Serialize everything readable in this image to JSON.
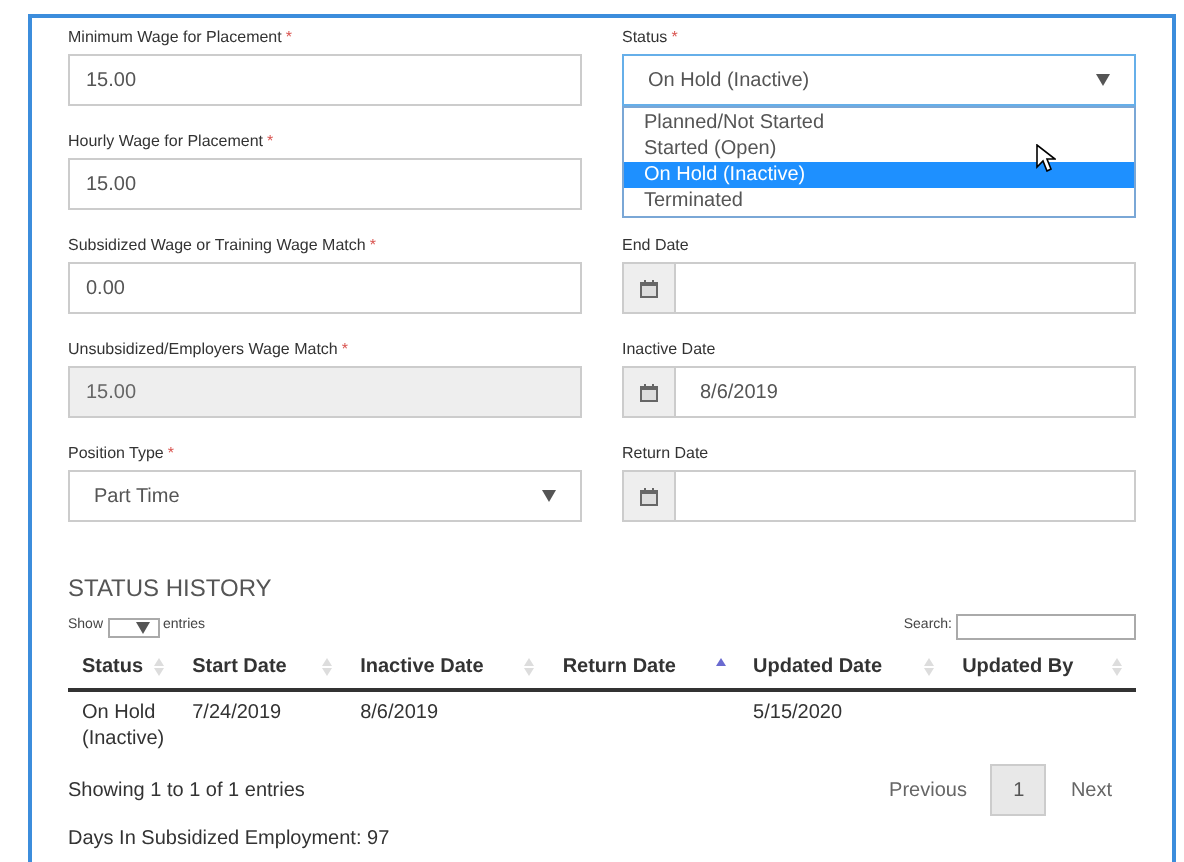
{
  "left_fields": [
    {
      "label": "Minimum Wage for Placement",
      "required_mark": "*",
      "kind": "text",
      "value": "15.00",
      "disabled": false
    },
    {
      "label": "Hourly Wage for Placement",
      "required_mark": "*",
      "kind": "text",
      "value": "15.00",
      "disabled": false
    },
    {
      "label": "Subsidized Wage or Training Wage Match",
      "required_mark": "*",
      "kind": "text",
      "value": "0.00",
      "disabled": false
    },
    {
      "label": "Unsubsidized/Employers Wage Match",
      "required_mark": "*",
      "kind": "text",
      "value": "15.00",
      "disabled": true
    },
    {
      "label": "Position Type",
      "required_mark": "*",
      "kind": "select",
      "value": "Part Time",
      "disabled": false
    }
  ],
  "status": {
    "label": "Status",
    "required_mark": "*",
    "value": "On Hold (Inactive)",
    "options": [
      {
        "label": "Planned/Not Started",
        "selected": false
      },
      {
        "label": "Started (Open)",
        "selected": false
      },
      {
        "label": "On Hold (Inactive)",
        "selected": true
      },
      {
        "label": "Terminated",
        "selected": false
      }
    ]
  },
  "right_fields": [
    {
      "label": "End Date",
      "kind": "date"
    },
    {
      "label": "Inactive Date",
      "kind": "date",
      "value": "8/6/2019"
    },
    {
      "label": "Return Date",
      "kind": "date"
    }
  ],
  "history": {
    "title": "STATUS HISTORY",
    "show_label": "Show",
    "entries_label": "entries",
    "search_label": "Search:",
    "columns": [
      {
        "label": "Status",
        "sorted": false
      },
      {
        "label": "Start Date",
        "sorted": false
      },
      {
        "label": "Inactive Date",
        "sorted": false
      },
      {
        "label": "Return Date",
        "sorted": true
      },
      {
        "label": "Updated Date",
        "sorted": false
      },
      {
        "label": "Updated By",
        "sorted": false
      }
    ],
    "rows": [
      [
        "On Hold (Inactive)",
        "7/24/2019",
        "8/6/2019",
        null,
        "5/15/2020",
        null
      ]
    ],
    "info": "Showing 1 to 1 of 1 entries",
    "pagination": [
      {
        "label": "Previous",
        "kind": "link",
        "selected": false
      },
      {
        "label": "1",
        "kind": "page",
        "selected": true
      },
      {
        "label": "Next",
        "kind": "link",
        "selected": false
      }
    ]
  },
  "days": "Days In Subsidized Employment: 97"
}
